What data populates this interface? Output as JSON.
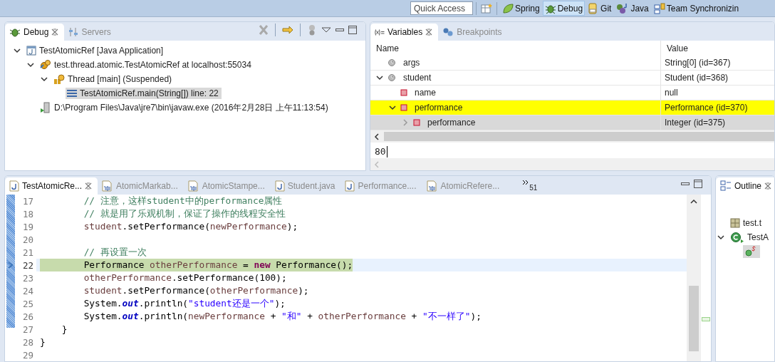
{
  "toolbar": {
    "quick_access": {
      "placeholder": "Quick Access"
    },
    "perspectives": [
      {
        "label": "Spring",
        "selected": false
      },
      {
        "label": "Debug",
        "selected": true
      },
      {
        "label": "Git",
        "selected": false
      },
      {
        "label": "Java",
        "selected": false
      },
      {
        "label": "Team Synchronizin",
        "selected": false
      }
    ]
  },
  "debug_view": {
    "tabs": [
      {
        "label": "Debug",
        "selected": true
      },
      {
        "label": "Servers",
        "selected": false
      }
    ],
    "tree": [
      {
        "label": "TestAtomicRef [Java Application]",
        "kind": "launch",
        "expanded": true,
        "selected": false,
        "children": [
          {
            "label": "test.thread.atomic.TestAtomicRef at localhost:55034",
            "kind": "target",
            "expanded": true,
            "selected": false,
            "children": [
              {
                "label": "Thread [main] (Suspended)",
                "kind": "thread",
                "expanded": true,
                "selected": false,
                "children": [
                  {
                    "label": "TestAtomicRef.main(String[]) line: 22",
                    "kind": "frame",
                    "selected": true
                  }
                ]
              }
            ]
          },
          {
            "label": "D:\\Program Files\\Java\\jre7\\bin\\javaw.exe (2016年2月28日 上午11:13:54)",
            "kind": "process",
            "selected": false
          }
        ]
      }
    ]
  },
  "variables_view": {
    "tabs": [
      {
        "label": "Variables",
        "selected": true
      },
      {
        "label": "Breakpoints",
        "selected": false
      }
    ],
    "columns": [
      "Name",
      "Value"
    ],
    "rows": [
      {
        "name": "args",
        "value": "String[0]  (id=367)",
        "kind": "local",
        "changed": false,
        "selected": false
      },
      {
        "name": "student",
        "value": "Student  (id=368)",
        "kind": "local",
        "expanded": true,
        "changed": false,
        "selected": false,
        "children": [
          {
            "name": "name",
            "value": "null",
            "kind": "field",
            "changed": false,
            "selected": false
          },
          {
            "name": "performance",
            "value": "Performance  (id=370)",
            "kind": "field",
            "expanded": true,
            "changed": true,
            "selected": false,
            "children": [
              {
                "name": "performance",
                "value": "Integer  (id=375)",
                "kind": "field",
                "expanded": false,
                "changed": false,
                "selected": true
              }
            ]
          }
        ]
      }
    ],
    "detail": "80"
  },
  "editor": {
    "tabs": [
      {
        "label": "TestAtomicRe...",
        "kind": "java",
        "selected": true
      },
      {
        "label": "AtomicMarkab...",
        "kind": "class",
        "selected": false
      },
      {
        "label": "AtomicStampe...",
        "kind": "class",
        "selected": false
      },
      {
        "label": "Student.java",
        "kind": "java",
        "selected": false
      },
      {
        "label": "Performance....",
        "kind": "java",
        "selected": false
      },
      {
        "label": "AtomicRefere...",
        "kind": "class",
        "selected": false
      }
    ],
    "overflow_count": "51",
    "lines": [
      {
        "number": "17",
        "current": false,
        "tokens": [
          {
            "kind": "comment",
            "t": "        // 注意，这样student中的performance属性"
          }
        ]
      },
      {
        "number": "18",
        "current": false,
        "tokens": [
          {
            "kind": "comment",
            "t": "        // 就是用了乐观机制，保证了操作的线程安全性"
          }
        ]
      },
      {
        "number": "19",
        "current": false,
        "tokens": [
          {
            "kind": "var",
            "t": "        student"
          },
          {
            "kind": "plain",
            "t": ".setPerformance("
          },
          {
            "kind": "var",
            "t": "newPerformance"
          },
          {
            "kind": "plain",
            "t": ");"
          }
        ]
      },
      {
        "number": "20",
        "current": false
      },
      {
        "number": "21",
        "current": false,
        "tokens": [
          {
            "kind": "comment",
            "t": "        // 再设置一次"
          }
        ]
      },
      {
        "number": "22",
        "current": true,
        "tokens": [
          {
            "kind": "plain",
            "t": "        Performance "
          },
          {
            "kind": "var",
            "t": "otherPerformance"
          },
          {
            "kind": "plain",
            "t": " = "
          },
          {
            "kind": "keyword",
            "t": "new"
          },
          {
            "kind": "plain",
            "t": " Performance();"
          }
        ]
      },
      {
        "number": "23",
        "current": false,
        "tokens": [
          {
            "kind": "var",
            "t": "        otherPerformance"
          },
          {
            "kind": "plain",
            "t": ".setPerformance(100);"
          }
        ]
      },
      {
        "number": "24",
        "current": false,
        "tokens": [
          {
            "kind": "var",
            "t": "        student"
          },
          {
            "kind": "plain",
            "t": ".setPerformance("
          },
          {
            "kind": "var",
            "t": "otherPerformance"
          },
          {
            "kind": "plain",
            "t": ");"
          }
        ]
      },
      {
        "number": "25",
        "current": false,
        "tokens": [
          {
            "kind": "plain",
            "t": "        System."
          },
          {
            "kind": "static",
            "t": "out"
          },
          {
            "kind": "plain",
            "t": ".println("
          },
          {
            "kind": "string",
            "t": "\"student还是一个\""
          },
          {
            "kind": "plain",
            "t": ");"
          }
        ]
      },
      {
        "number": "26",
        "current": false,
        "tokens": [
          {
            "kind": "plain",
            "t": "        System."
          },
          {
            "kind": "static",
            "t": "out"
          },
          {
            "kind": "plain",
            "t": ".println("
          },
          {
            "kind": "var",
            "t": "newPerformance"
          },
          {
            "kind": "plain",
            "t": " + "
          },
          {
            "kind": "string",
            "t": "\"和\""
          },
          {
            "kind": "plain",
            "t": " + "
          },
          {
            "kind": "var",
            "t": "otherPerformance"
          },
          {
            "kind": "plain",
            "t": " + "
          },
          {
            "kind": "string",
            "t": "\"不一样了\""
          },
          {
            "kind": "plain",
            "t": ");"
          }
        ]
      },
      {
        "number": "27",
        "current": false,
        "tokens": [
          {
            "kind": "plain",
            "t": "    }"
          }
        ]
      },
      {
        "number": "28",
        "current": false,
        "tokens": [
          {
            "kind": "plain",
            "t": "}"
          }
        ]
      },
      {
        "number": "29",
        "current": false
      }
    ]
  },
  "outline_view": {
    "tabs": [
      {
        "label": "Outline",
        "selected": true
      }
    ],
    "tree": [
      {
        "label": "test.t",
        "kind": "package",
        "selected": false
      },
      {
        "label": "TestA",
        "kind": "class",
        "expanded": true,
        "selected": false,
        "children": [
          {
            "kind": "method",
            "selected": true
          }
        ]
      }
    ]
  }
}
